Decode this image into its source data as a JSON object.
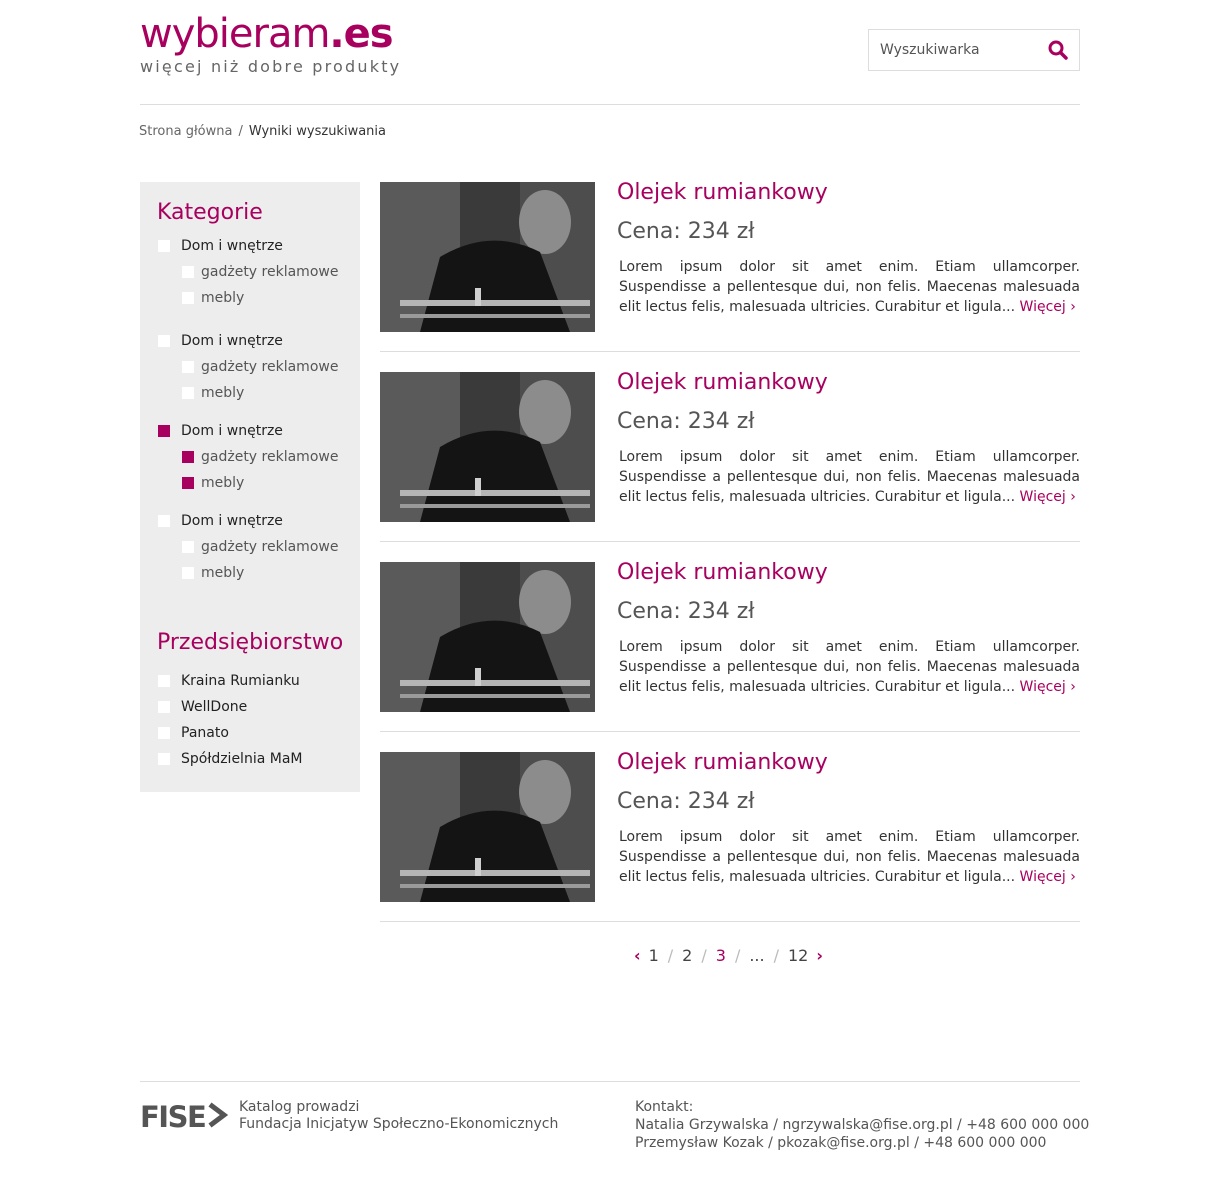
{
  "header": {
    "logo_main": "wybieram",
    "logo_tld": ".es",
    "logo_tagline": "więcej niż dobre produkty",
    "search_placeholder": "Wyszukiwarka"
  },
  "breadcrumb": {
    "home": "Strona główna",
    "separator": "/",
    "current": "Wyniki wyszukiwania"
  },
  "sidebar": {
    "categories_title": "Kategorie",
    "category_groups": [
      {
        "label": "Dom i wnętrze",
        "checked": false,
        "children": [
          {
            "label": "gadżety reklamowe",
            "checked": false
          },
          {
            "label": "mebly",
            "checked": false
          }
        ]
      },
      {
        "label": "Dom i wnętrze",
        "checked": false,
        "children": [
          {
            "label": "gadżety reklamowe",
            "checked": false
          },
          {
            "label": "mebly",
            "checked": false
          }
        ]
      },
      {
        "label": "Dom i wnętrze",
        "checked": true,
        "children": [
          {
            "label": "gadżety reklamowe",
            "checked": true
          },
          {
            "label": "mebly",
            "checked": true
          }
        ]
      },
      {
        "label": "Dom i wnętrze",
        "checked": false,
        "children": [
          {
            "label": "gadżety reklamowe",
            "checked": false
          },
          {
            "label": "mebly",
            "checked": false
          }
        ]
      }
    ],
    "companies_title": "Przedsiębiorstwo",
    "companies": [
      {
        "label": "Kraina Rumianku",
        "checked": false
      },
      {
        "label": "WellDone",
        "checked": false
      },
      {
        "label": "Panato",
        "checked": false
      },
      {
        "label": "Spółdzielnia MaM",
        "checked": false
      }
    ]
  },
  "products": [
    {
      "title": "Olejek rumiankowy",
      "price": "Cena: 234 zł",
      "description": "Lorem ipsum dolor sit amet enim. Etiam ullamcorper. Suspendisse a pellentesque dui, non felis. Maecenas malesuada elit lectus felis, malesuada ultricies. Curabitur et ligula...",
      "more": "Więcej ›"
    },
    {
      "title": "Olejek rumiankowy",
      "price": "Cena: 234 zł",
      "description": "Lorem ipsum dolor sit amet enim. Etiam ullamcorper. Suspendisse a pellentesque dui, non felis. Maecenas malesuada elit lectus felis, malesuada ultricies. Curabitur et ligula...",
      "more": "Więcej ›"
    },
    {
      "title": "Olejek rumiankowy",
      "price": "Cena: 234 zł",
      "description": "Lorem ipsum dolor sit amet enim. Etiam ullamcorper. Suspendisse a pellentesque dui, non felis. Maecenas malesuada elit lectus felis, malesuada ultricies. Curabitur et ligula...",
      "more": "Więcej ›"
    },
    {
      "title": "Olejek rumiankowy",
      "price": "Cena: 234 zł",
      "description": "Lorem ipsum dolor sit amet enim. Etiam ullamcorper. Suspendisse a pellentesque dui, non felis. Maecenas malesuada elit lectus felis, malesuada ultricies. Curabitur et ligula...",
      "more": "Więcej ›"
    }
  ],
  "pagination": {
    "prev": "‹",
    "pages": [
      "1",
      "2",
      "3",
      "...",
      "12"
    ],
    "current": "3",
    "separator": "/",
    "next": "›"
  },
  "footer": {
    "logo_text": "FISE",
    "org_line1": "Katalog prowadzi",
    "org_line2": "Fundacja Inicjatyw Społeczno-Ekonomicznych",
    "contact_label": "Kontakt:",
    "contact_line1": "Natalia Grzywalska / ngrzywalska@fise.org.pl / +48 600 000 000",
    "contact_line2": "Przemysław Kozak / pkozak@fise.org.pl / +48 600 000 000"
  },
  "colors": {
    "accent": "#a8005f",
    "sidebar_bg": "#ededed",
    "divider": "#dddddd"
  },
  "icons": {
    "search": "search-icon",
    "fise_logo": "fise-logo"
  }
}
